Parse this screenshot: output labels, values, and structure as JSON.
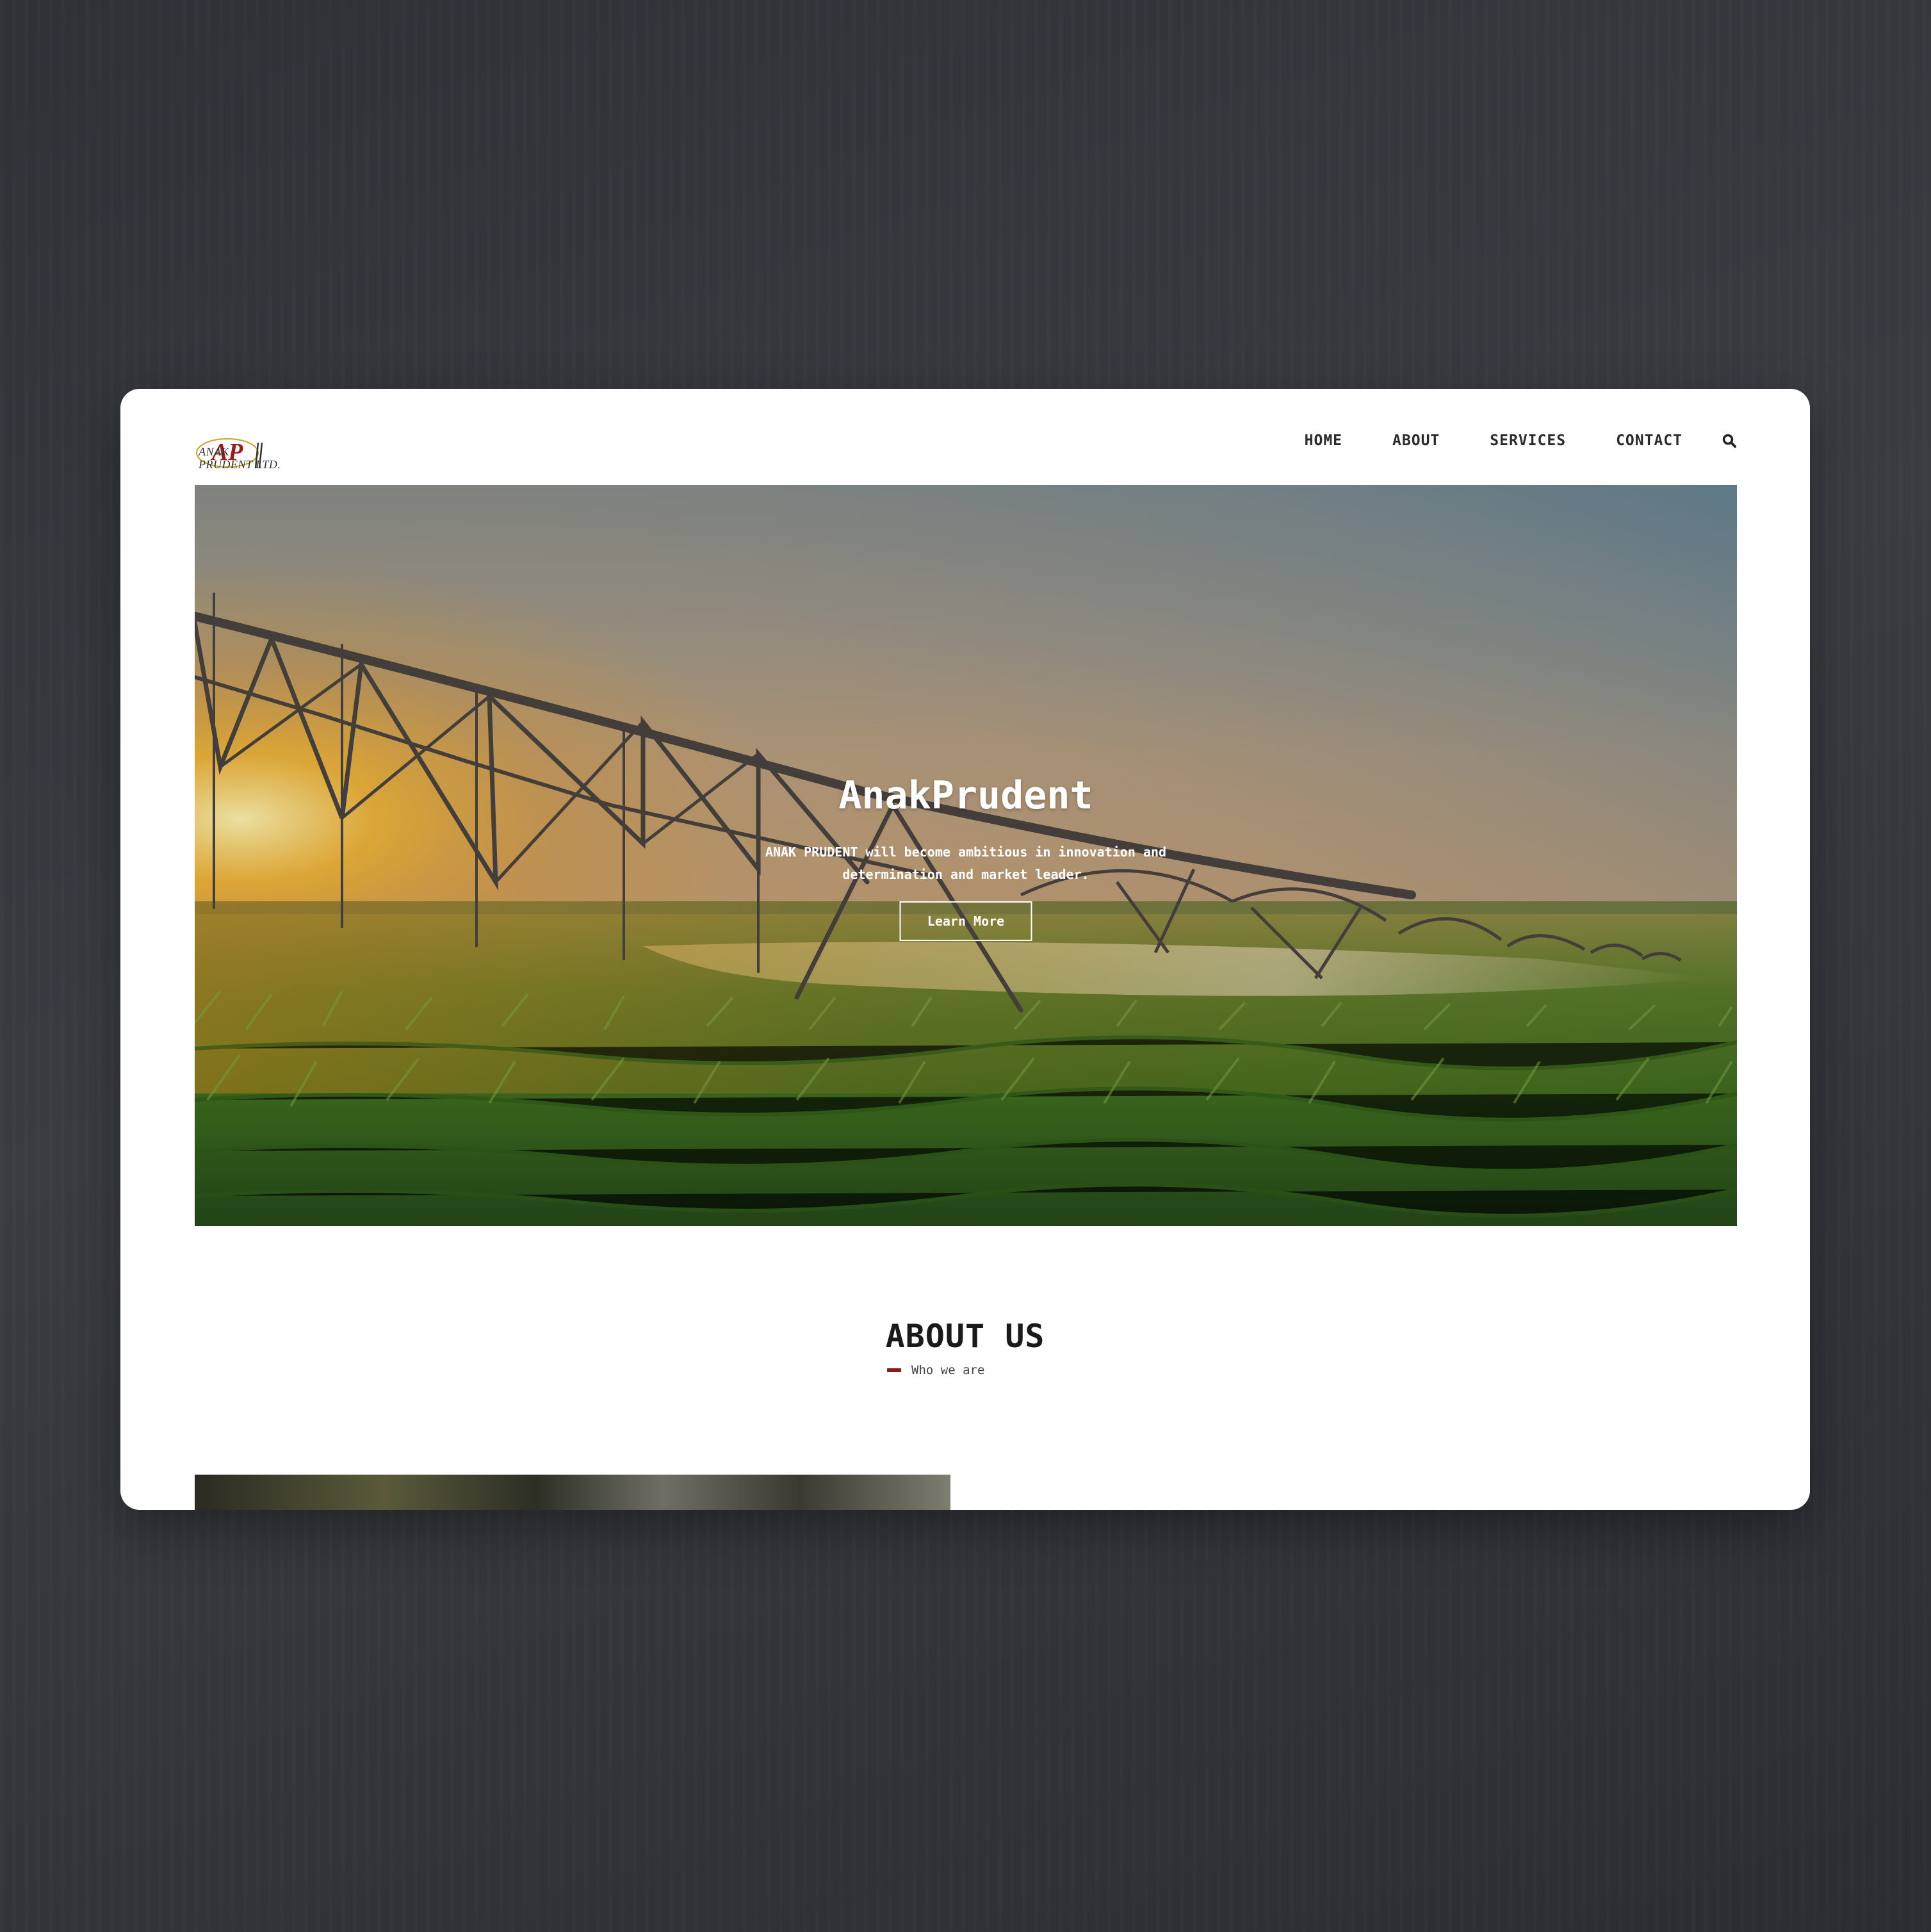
{
  "brand": {
    "monogram": "AP",
    "line1": "ANAK",
    "line2": "PRUDENT LTD.",
    "accent_color": "#8b1a1a"
  },
  "nav": {
    "items": [
      "HOME",
      "ABOUT",
      "SERVICES",
      "CONTACT"
    ],
    "search_icon": "search-icon"
  },
  "hero": {
    "title": "AnakPrudent",
    "subtitle": "ANAK PRUDENT will become ambitious in innovation and determination and market leader.",
    "button_label": "Learn More"
  },
  "about": {
    "title": "ABOUT US",
    "subtitle": "Who we are"
  }
}
